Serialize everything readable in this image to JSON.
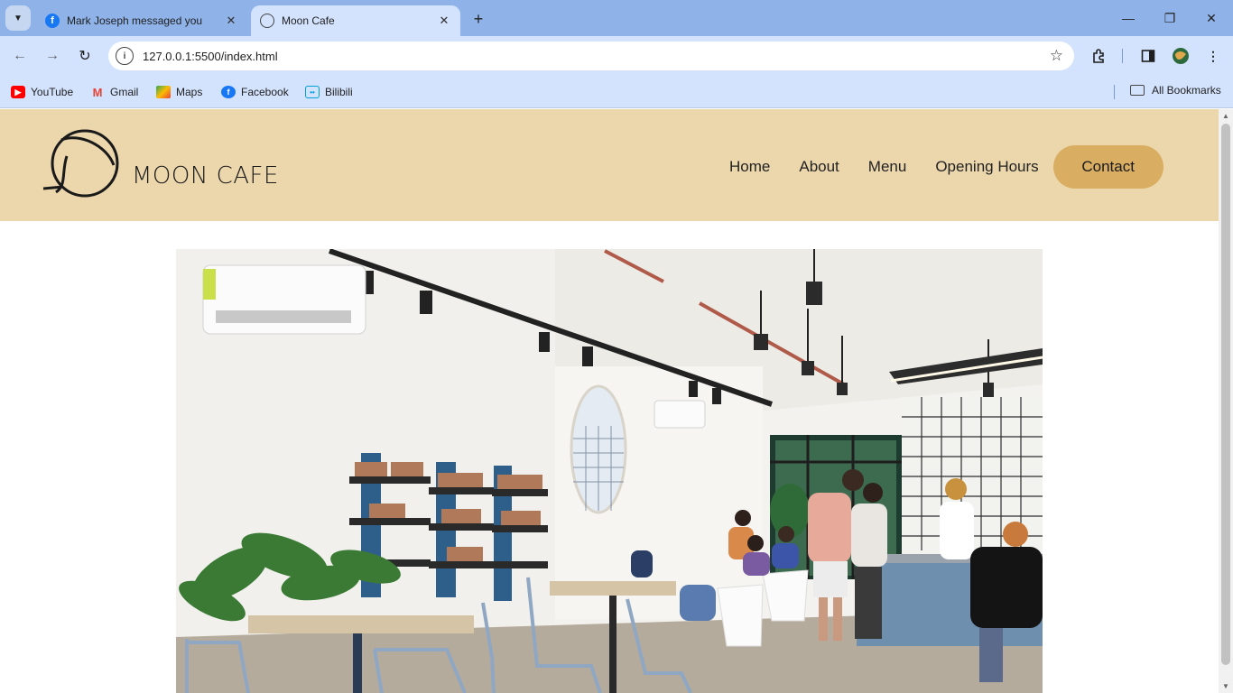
{
  "browser": {
    "tabs": [
      {
        "title": "Mark Joseph messaged you",
        "icon": "facebook-icon",
        "active": false
      },
      {
        "title": "Moon Cafe",
        "icon": "globe-icon",
        "active": true
      }
    ],
    "url": "127.0.0.1:5500/index.html",
    "bookmarks": [
      {
        "label": "YouTube",
        "icon": "youtube-icon"
      },
      {
        "label": "Gmail",
        "icon": "gmail-icon"
      },
      {
        "label": "Maps",
        "icon": "maps-icon"
      },
      {
        "label": "Facebook",
        "icon": "facebook-icon"
      },
      {
        "label": "Bilibili",
        "icon": "bilibili-icon"
      }
    ],
    "all_bookmarks": "All Bookmarks"
  },
  "site": {
    "logo_text": "MOON CAFE",
    "nav": [
      "Home",
      "About",
      "Menu",
      "Opening Hours"
    ],
    "contact": "Contact",
    "colors": {
      "header_bg": "#ecd7ad",
      "contact_bg": "#d9ae62"
    }
  }
}
